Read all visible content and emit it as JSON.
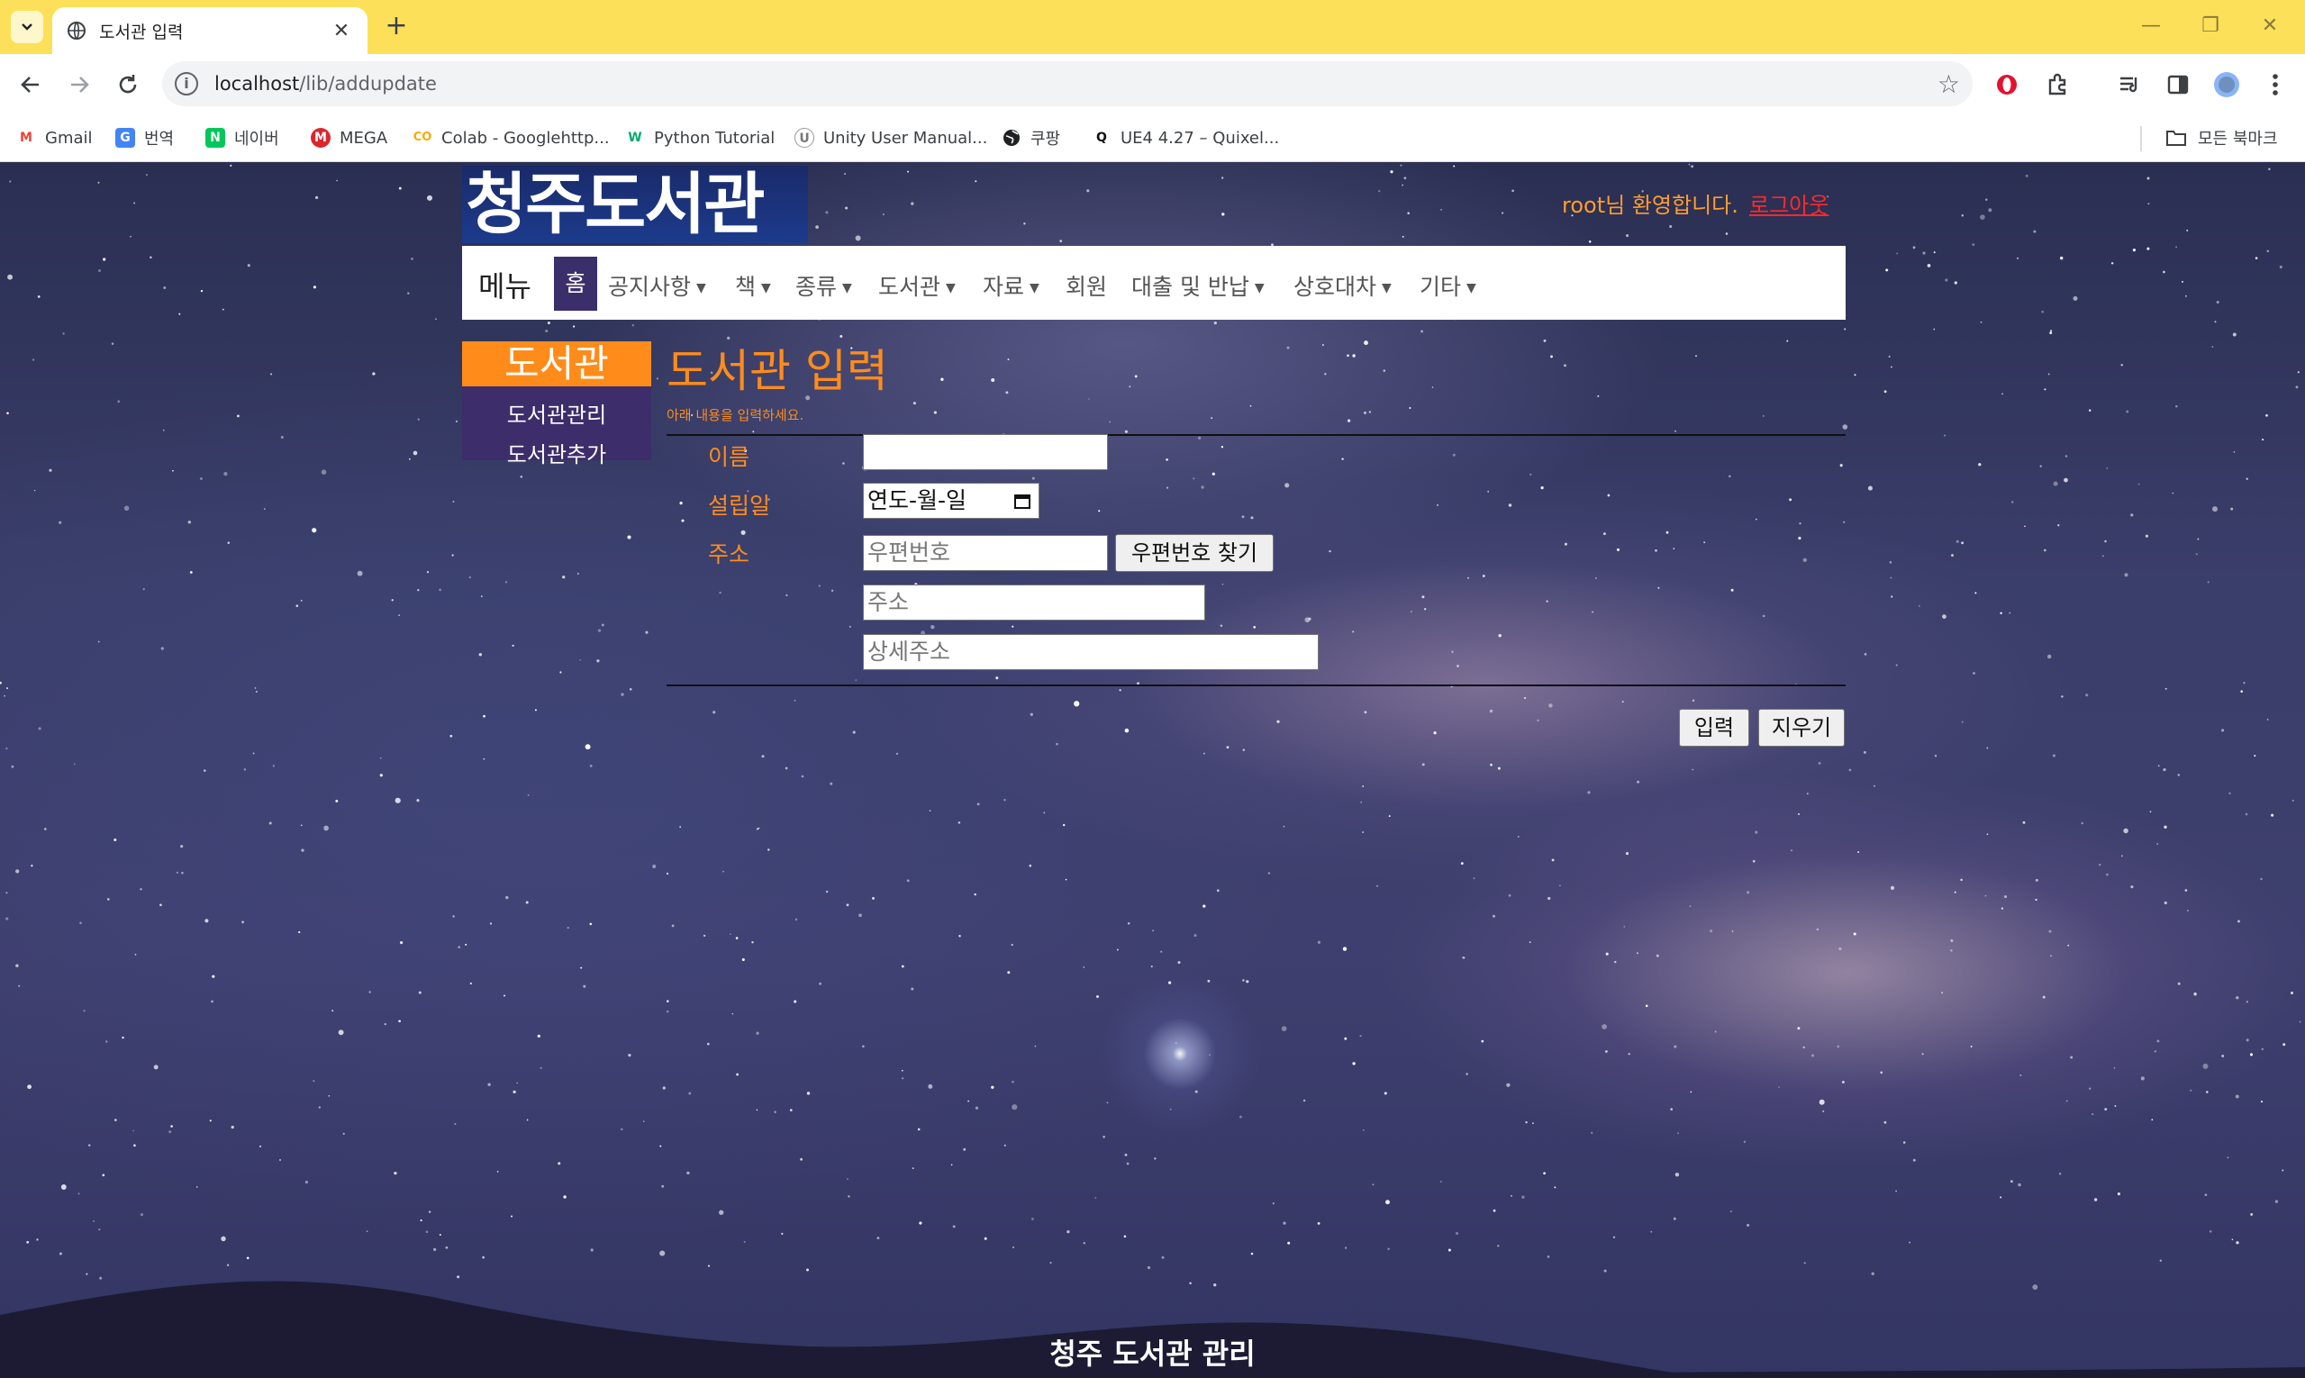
{
  "browser": {
    "tab_title": "도서관 입력",
    "url_host": "localhost",
    "url_path": "/lib/addupdate",
    "bookmarks": [
      {
        "label": "Gmail",
        "icon": "gmail-icon",
        "icon_text": "M",
        "color": "#ea4335"
      },
      {
        "label": "번역",
        "icon": "translate-icon",
        "icon_text": "G",
        "color": "#4285f4"
      },
      {
        "label": "네이버",
        "icon": "naver-icon",
        "icon_text": "N",
        "color": "#03c75a"
      },
      {
        "label": "MEGA",
        "icon": "mega-icon",
        "icon_text": "M",
        "color": "#d9272e"
      },
      {
        "label": "Colab - Googlehttp...",
        "icon": "colab-icon",
        "icon_text": "CO",
        "color": "#f9ab00"
      },
      {
        "label": "Python Tutorial",
        "icon": "w3schools-icon",
        "icon_text": "W",
        "color": "#04aa6d"
      },
      {
        "label": "Unity User Manual...",
        "icon": "unity-icon",
        "icon_text": "U",
        "color": "#777777"
      },
      {
        "label": "쿠팡",
        "icon": "globe-icon",
        "icon_text": "",
        "color": "#202124"
      },
      {
        "label": "UE4 4.27 – Quixel...",
        "icon": "quixel-icon",
        "icon_text": "Q",
        "color": "#111111"
      }
    ],
    "all_bookmarks": "모든 북마크"
  },
  "site": {
    "logo": "청주도서관",
    "welcome": "root님 환영합니다.",
    "logout": "로그아웃",
    "menu_brand": "메뉴",
    "nav": [
      {
        "label": "홈",
        "dropdown": false
      },
      {
        "label": "공지사항",
        "dropdown": true
      },
      {
        "label": "책",
        "dropdown": true
      },
      {
        "label": "종류",
        "dropdown": true
      },
      {
        "label": "도서관",
        "dropdown": true
      },
      {
        "label": "자료",
        "dropdown": true
      },
      {
        "label": "회원",
        "dropdown": false
      },
      {
        "label": "대출 및 반납",
        "dropdown": true
      },
      {
        "label": "상호대차",
        "dropdown": true
      },
      {
        "label": "기타",
        "dropdown": true
      }
    ],
    "sidebar": {
      "title": "도서관",
      "items": [
        "도서관관리",
        "도서관추가"
      ]
    },
    "form": {
      "title": "도서관 입력",
      "subtitle": "아래 내용을 입력하세요.",
      "name_label": "이름",
      "name_value": "",
      "founded_label": "설립일",
      "founded_placeholder": "연도-월-일",
      "address_label": "주소",
      "zip_placeholder": "우편번호",
      "zip_button": "우편번호 찾기",
      "address_placeholder": "주소",
      "detail_placeholder": "상세주소",
      "submit_button": "입력",
      "clear_button": "지우기"
    },
    "footer": "청주 도서관 관리"
  }
}
